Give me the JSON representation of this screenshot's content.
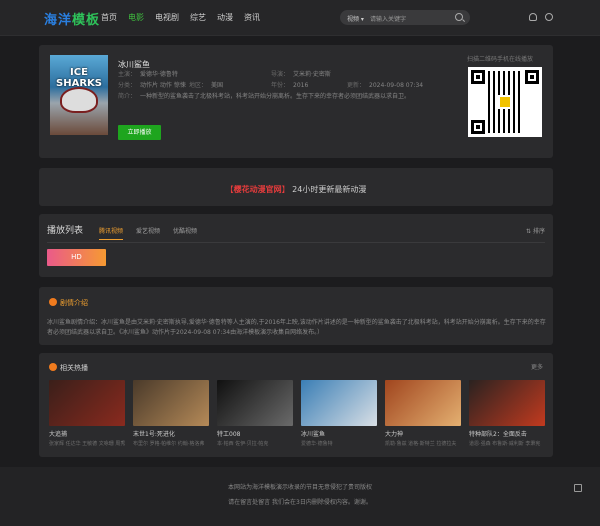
{
  "header": {
    "logo_main": "海洋",
    "logo_accent": "模板",
    "nav": [
      "首页",
      "电影",
      "电视剧",
      "综艺",
      "动漫",
      "资讯"
    ],
    "search": {
      "category": "视频",
      "placeholder": "请输入关键字"
    }
  },
  "movie": {
    "poster_text": "ICE SHARKS",
    "title": "冰川鲨鱼",
    "starring_label": "主演：",
    "starring": "爱德华·德鲁特",
    "director_label": "导演：",
    "director": "艾米莉·史密斯",
    "genre_label": "分类：",
    "genre": "动作片 动作 惊悚",
    "region_label": "地区：",
    "region": "美国",
    "year_label": "年份：",
    "year": "2016",
    "updated_label": "更新：",
    "updated": "2024-09-08 07:34",
    "summary_label": "简介：",
    "summary": "一种新型的鲨鱼袭击了北极科考站，科考站开始分崩离析。生存下来的幸存者必须团结武器以求自卫。",
    "play_label": "立即播放",
    "qr_caption": "扫描二维码手机在线播放"
  },
  "notice": {
    "bracket_left": "【",
    "highlight": "樱花动漫官网",
    "bracket_right": "】",
    "text": "24小时更新最新动漫"
  },
  "playlist": {
    "title": "播放列表",
    "tabs": [
      "腾讯视频",
      "爱艺视频",
      "优酷视频"
    ],
    "sort": "排序",
    "episode": "HD"
  },
  "intro": {
    "title": "剧情介绍",
    "text": "冰川鲨鱼剧情介绍：冰川鲨鱼是由艾米莉·史密斯执导,爱德华·德鲁特等人主演的,于2016年上映,该动作片讲述的是一种新型的鲨鱼袭击了北极科考站，科考站开始分崩离析。生存下来的幸存者必须团结武器以求自卫。《冰川鲨鱼》动作片于2024-09-08 07:34由海洋模板演示收集自网络发布。）"
  },
  "related": {
    "title": "相关热播",
    "more": "更多",
    "items": [
      {
        "title": "大追捕",
        "cast": "张家辉 任达华 王敏德 文咏珊 周秀娜",
        "colors": [
          "#3a1f1a",
          "#8a2a1e"
        ]
      },
      {
        "title": "末世1号:死进化",
        "cast": "布里尔 罗格·帕维尔 约翰·格洛弗",
        "colors": [
          "#4a3a2a",
          "#b58a58"
        ]
      },
      {
        "title": "特工008",
        "cast": "本·帕西 佐伊·贝拉·帕克",
        "colors": [
          "#101010",
          "#6a6a6a"
        ]
      },
      {
        "title": "冰川鲨鱼",
        "cast": "爱德华·德鲁特",
        "colors": [
          "#3a7eb5",
          "#d9dfe5"
        ]
      },
      {
        "title": "大力神",
        "cast": "凯勒·鲁兹 道格·斯特兰 拉德拉夫",
        "colors": [
          "#a0451e",
          "#e4b071"
        ]
      },
      {
        "title": "特种部队2：全面反击",
        "cast": "道恩·强森 布鲁斯·威利斯 李秉宪",
        "colors": [
          "#2a2220",
          "#c23a1f"
        ]
      }
    ]
  },
  "footer": {
    "line1": "本网站为海洋模板演示收录的节目无意侵犯了贵司版权",
    "line2": "请在留言处留言 我们会在3日内删除侵权内容。谢谢。"
  },
  "chart_data": null
}
